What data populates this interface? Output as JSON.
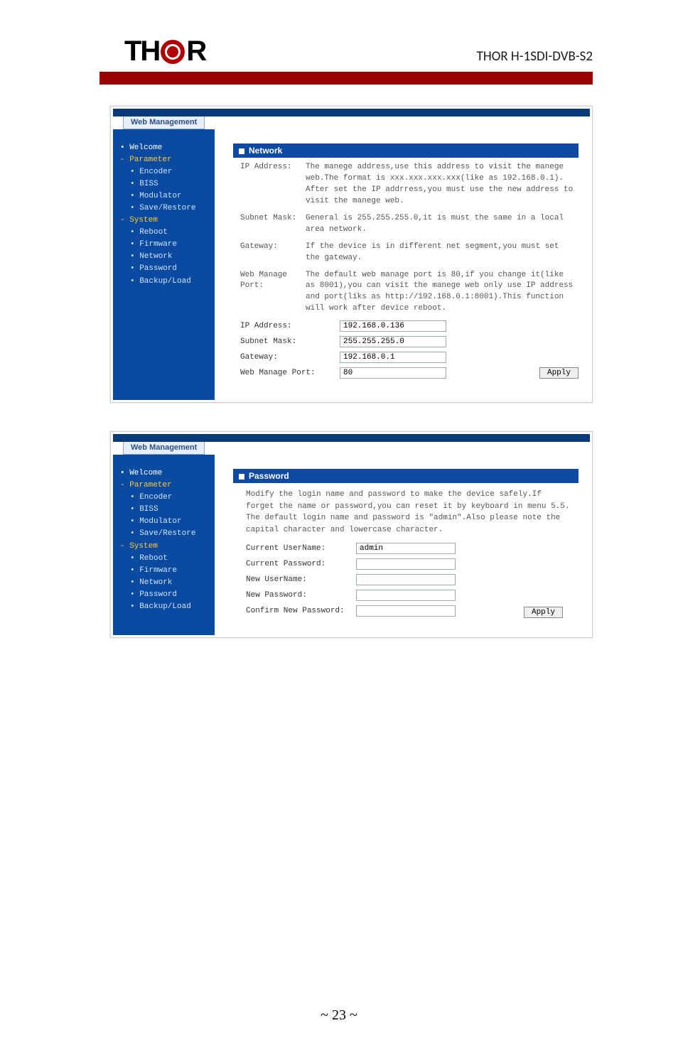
{
  "header": {
    "logo_left": "TH",
    "logo_right": "R",
    "product": "THOR H-1SDI-DVB-S2"
  },
  "tabs": {
    "web_management": "Web Management"
  },
  "sidebar": {
    "welcome": "Welcome",
    "parameter": "Parameter",
    "encoder": "Encoder",
    "biss": "BISS",
    "modulator": "Modulator",
    "save_restore": "Save/Restore",
    "system": "System",
    "reboot": "Reboot",
    "firmware": "Firmware",
    "network": "Network",
    "password": "Password",
    "backup_load": "Backup/Load"
  },
  "network": {
    "panel_title": "Network",
    "rows": {
      "ip_label": "IP Address:",
      "ip_desc": "The manege address,use this address to visit the manege web.The format is xxx.xxx.xxx.xxx(like as 192.168.0.1). After set the IP addrress,you must use the new address to visit the manege web.",
      "mask_label": "Subnet Mask:",
      "mask_desc": "General is 255.255.255.0,it is must the same in a local area network.",
      "gw_label": "Gateway:",
      "gw_desc": "If the device is in different net segment,you must set the gateway.",
      "port_label": "Web Manage Port:",
      "port_desc": "The default web manage port is 80,if you change it(like as 8001),you can visit the manege web only use IP address and port(liks as http://192.168.0.1:8001).This function will work after device reboot."
    },
    "form": {
      "ip_label": "IP Address:",
      "ip_value": "192.168.0.136",
      "mask_label": "Subnet Mask:",
      "mask_value": "255.255.255.0",
      "gw_label": "Gateway:",
      "gw_value": "192.168.0.1",
      "port_label": "Web Manage Port:",
      "port_value": "80",
      "apply": "Apply"
    }
  },
  "password": {
    "panel_title": "Password",
    "desc": "Modify the login name and password to make the device safely.If forget the name or password,you can reset it by keyboard in menu 5.5. The default login name and password is \"admin\".Also please note the capital character and lowercase character.",
    "fields": {
      "cur_user_label": "Current UserName:",
      "cur_user_value": "admin",
      "cur_pw_label": "Current Password:",
      "new_user_label": "New UserName:",
      "new_pw_label": "New Password:",
      "confirm_label": "Confirm New Password:",
      "apply": "Apply"
    }
  },
  "footer": {
    "page": "~ 23 ~"
  }
}
